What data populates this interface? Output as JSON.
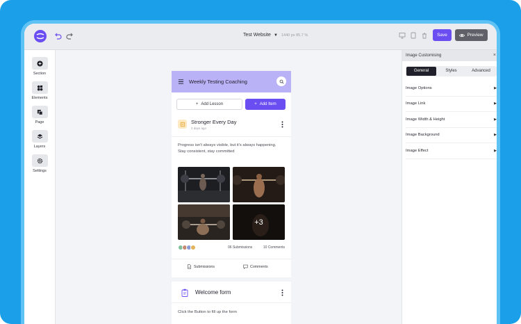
{
  "topbar": {
    "site_name": "Test Website",
    "canvas_meta": "1440 px  85.7 %",
    "save_label": "Save",
    "preview_label": "Preview"
  },
  "sidebar": {
    "items": [
      {
        "label": "Section",
        "icon": "plus-circle-icon"
      },
      {
        "label": "Elements",
        "icon": "elements-icon"
      },
      {
        "label": "Page",
        "icon": "page-icon"
      },
      {
        "label": "Layers",
        "icon": "layers-icon"
      },
      {
        "label": "Settings",
        "icon": "gear-icon"
      }
    ]
  },
  "phone": {
    "title": "Weekly Testing Coaching",
    "add_lesson_label": "Add Lesson",
    "add_item_label": "Add Item",
    "post": {
      "title": "Stronger Every Day",
      "time": "2 days ago",
      "text": "Progress isn't always visible, but it's always happening. Stay consistent, stay committed",
      "more_count": "+3",
      "submissions_count": "06 Submissions",
      "comments_count": "10 Comments",
      "submissions_label": "Submissions",
      "comments_label": "Comments"
    },
    "form": {
      "title": "Welcome form",
      "description": "Click the Button to fill up the form"
    }
  },
  "panel": {
    "title": "Image Customising",
    "tabs": [
      "General",
      "Styles",
      "Advanced"
    ],
    "active_tab": "General",
    "rows": [
      "Image Options",
      "Image Link",
      "Image Width & Height",
      "Image Background",
      "Image Effect"
    ]
  },
  "colors": {
    "accent": "#6b4ef2",
    "header": "#b9b2f6",
    "frame": "#1a9fe8"
  }
}
